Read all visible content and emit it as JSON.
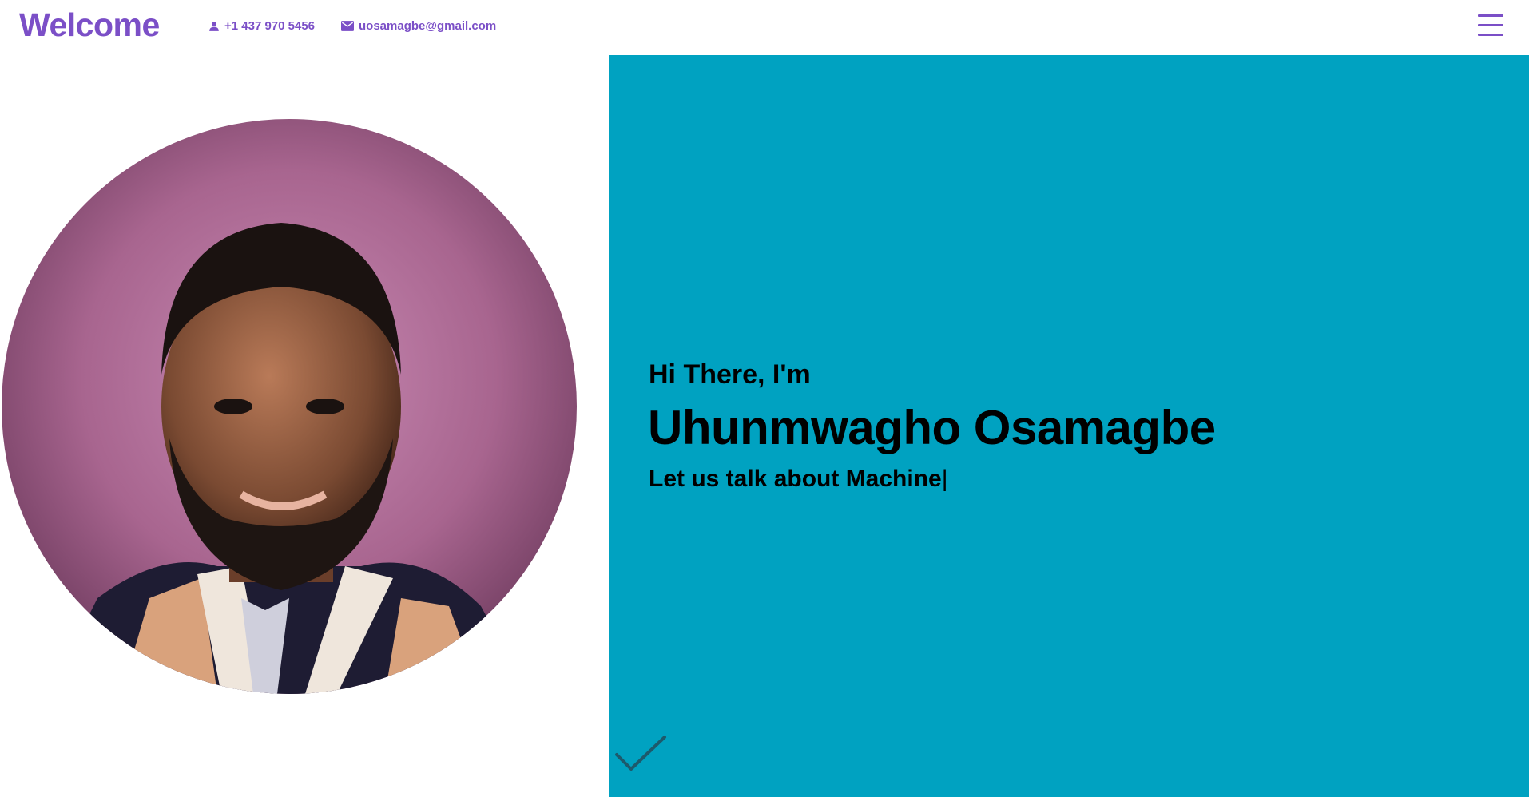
{
  "header": {
    "brand": "Welcome",
    "phone": "+1 437 970 5456",
    "email": "uosamagbe@gmail.com",
    "icons": {
      "phone": "person-icon",
      "email": "mail-icon",
      "menu": "hamburger-menu-icon"
    }
  },
  "hero": {
    "greeting": "Hi There, I'm",
    "name": "Uhunmwagho Osamagbe",
    "tagline": "Let us talk about Machine",
    "cursor": "|",
    "decor_icon": "checkmark-icon"
  },
  "colors": {
    "accent": "#7b4fc7",
    "hero_background": "#00a2c1",
    "text": "#000000",
    "check": "#1d5a6c"
  }
}
